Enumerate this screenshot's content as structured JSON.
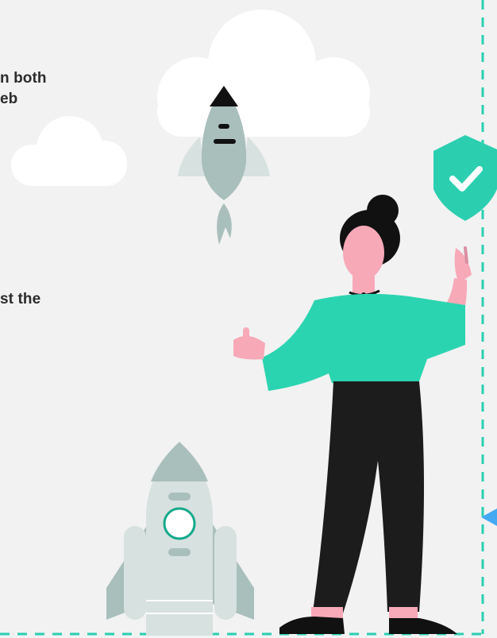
{
  "text_fragments": {
    "line_1": "n both",
    "line_2": "eb",
    "line_3": "st the"
  },
  "colors": {
    "background": "#f2f2f2",
    "dashed_border": "#2bcfb0",
    "shield": "#2bcfb0",
    "sweater": "#2bd4b0",
    "pants": "#1c1c1c",
    "skin": "#f7a9b8",
    "rocket_body": "#a9bfbc",
    "rocket_light": "#d7e1df",
    "arrow_accent": "#43aaf2"
  },
  "icons": [
    "cloud-icon",
    "rocket-icon",
    "shield-check-icon",
    "woman-illustration",
    "arrow-pointer-icon"
  ]
}
